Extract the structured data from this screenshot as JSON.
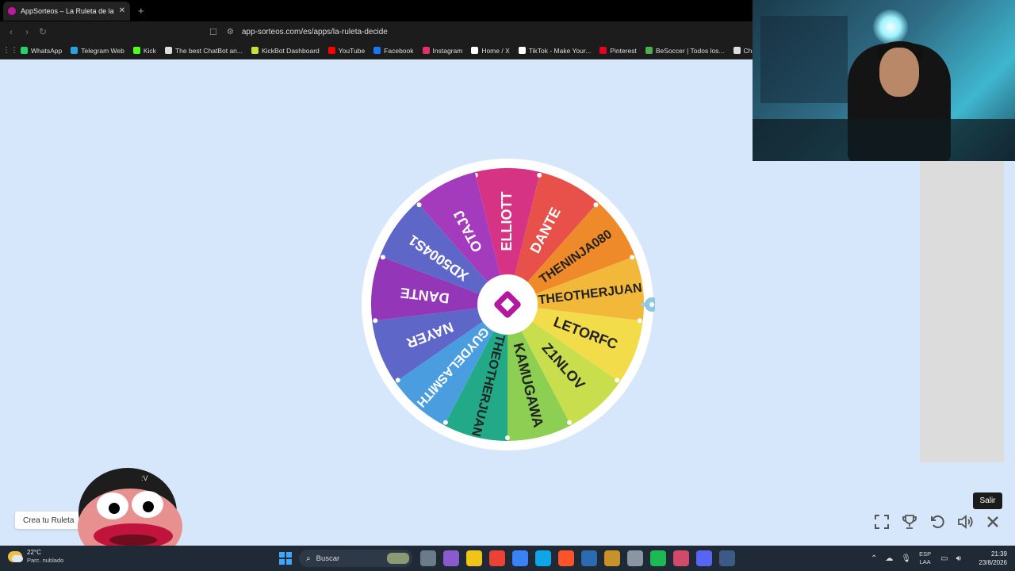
{
  "browser": {
    "tab_title": "AppSorteos – La Ruleta de la Su...",
    "tab_close": "✕",
    "new_tab": "+",
    "nav": {
      "back": "‹",
      "forward": "›",
      "reload": "↻"
    },
    "url": "app-sorteos.com/es/apps/la-ruleta-decide",
    "bookmarks": [
      {
        "label": "WhatsApp",
        "color": "#25d366"
      },
      {
        "label": "Telegram Web",
        "color": "#2aa1da"
      },
      {
        "label": "Kick",
        "color": "#53fc18"
      },
      {
        "label": "The best ChatBot an...",
        "color": "#dddddd"
      },
      {
        "label": "KickBot Dashboard",
        "color": "#c7e03a"
      },
      {
        "label": "YouTube",
        "color": "#ff0000"
      },
      {
        "label": "Facebook",
        "color": "#1877f2"
      },
      {
        "label": "Instagram",
        "color": "#e1306c"
      },
      {
        "label": "Home / X",
        "color": "#ffffff"
      },
      {
        "label": "TikTok - Make Your...",
        "color": "#ffffff"
      },
      {
        "label": "Pinterest",
        "color": "#e60023"
      },
      {
        "label": "BeSoccer | Todos los...",
        "color": "#4caf50"
      },
      {
        "label": "ChatGPT",
        "color": "#dddddd"
      }
    ]
  },
  "wheel": {
    "segments": [
      {
        "label": "ELLIOTT",
        "color": "#d63384"
      },
      {
        "label": "DANTE",
        "color": "#e8504a"
      },
      {
        "label": "THENINJA080",
        "color": "#ef8a2a"
      },
      {
        "label": "THEOTHERJUAN",
        "color": "#f2b83a"
      },
      {
        "label": "LETORFC",
        "color": "#f3dc4a"
      },
      {
        "label": "Z1NLOV",
        "color": "#c8de4c"
      },
      {
        "label": "KAMUGAWA",
        "color": "#8ccf52"
      },
      {
        "label": "THEOTHERJUAN",
        "color": "#22aa88"
      },
      {
        "label": "GUYDELASMITH",
        "color": "#4a9ee0"
      },
      {
        "label": "NAYER",
        "color": "#5e66c8"
      },
      {
        "label": "DANTE",
        "color": "#9436b8"
      },
      {
        "label": "XD5004S1",
        "color": "#5e66c8"
      },
      {
        "label": "OTAJJ",
        "color": "#a43bbc"
      }
    ],
    "dark_text_labels": [
      "THENINJA080",
      "THEOTHERJUAN",
      "LETORFC",
      "Z1NLOV",
      "KAMUGAWA"
    ]
  },
  "controls": {
    "tooltip": "Salir",
    "fullscreen_icon": "fullscreen-icon",
    "trophy_icon": "trophy-icon",
    "reset_icon": "reset-icon",
    "sound_icon": "sound-icon",
    "close_icon": "close-icon"
  },
  "crea_label": "Crea tu Ruleta",
  "taskbar": {
    "temperature": "22°C",
    "weather": "Parc. nublado",
    "search_placeholder": "Buscar",
    "lang_top": "ESP",
    "lang_bottom": "LAA",
    "time": "21:39",
    "date": "23/8/2026",
    "apps": [
      "#6b7b8c",
      "#8a5bd0",
      "#f0c419",
      "#ea4335",
      "#3b82f6",
      "#0ea5e9",
      "#fb542b",
      "#2b6cb0",
      "#c8922a",
      "#8b96a3",
      "#1db954",
      "#d04a6a",
      "#5865f2",
      "#3b5a86"
    ]
  }
}
